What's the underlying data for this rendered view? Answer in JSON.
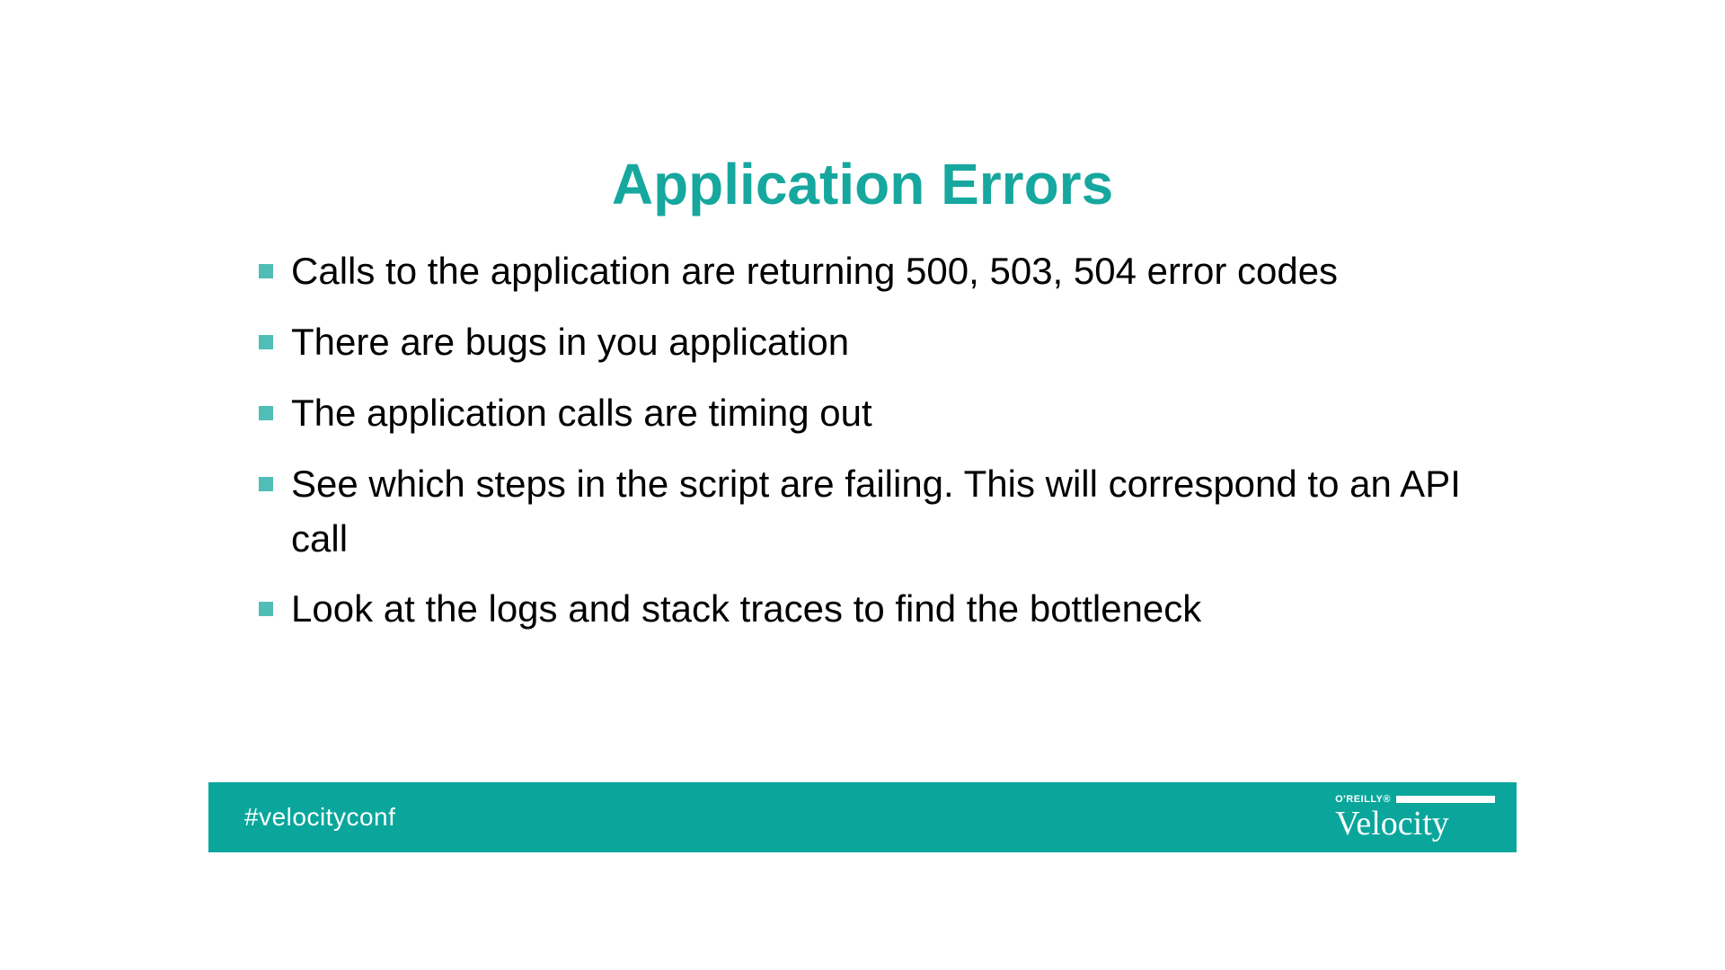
{
  "slide": {
    "title": "Application Errors",
    "bullets": [
      "Calls to the application are returning 500, 503, 504 error codes",
      "There are bugs in you application",
      "The application calls are timing out",
      "See which steps in the script are failing. This will correspond to an API call",
      "Look at the logs and stack traces to find the bottleneck"
    ]
  },
  "footer": {
    "hashtag": "#velocityconf",
    "logo_oreilly": "O'REILLY®",
    "logo_main": "Velocity"
  }
}
